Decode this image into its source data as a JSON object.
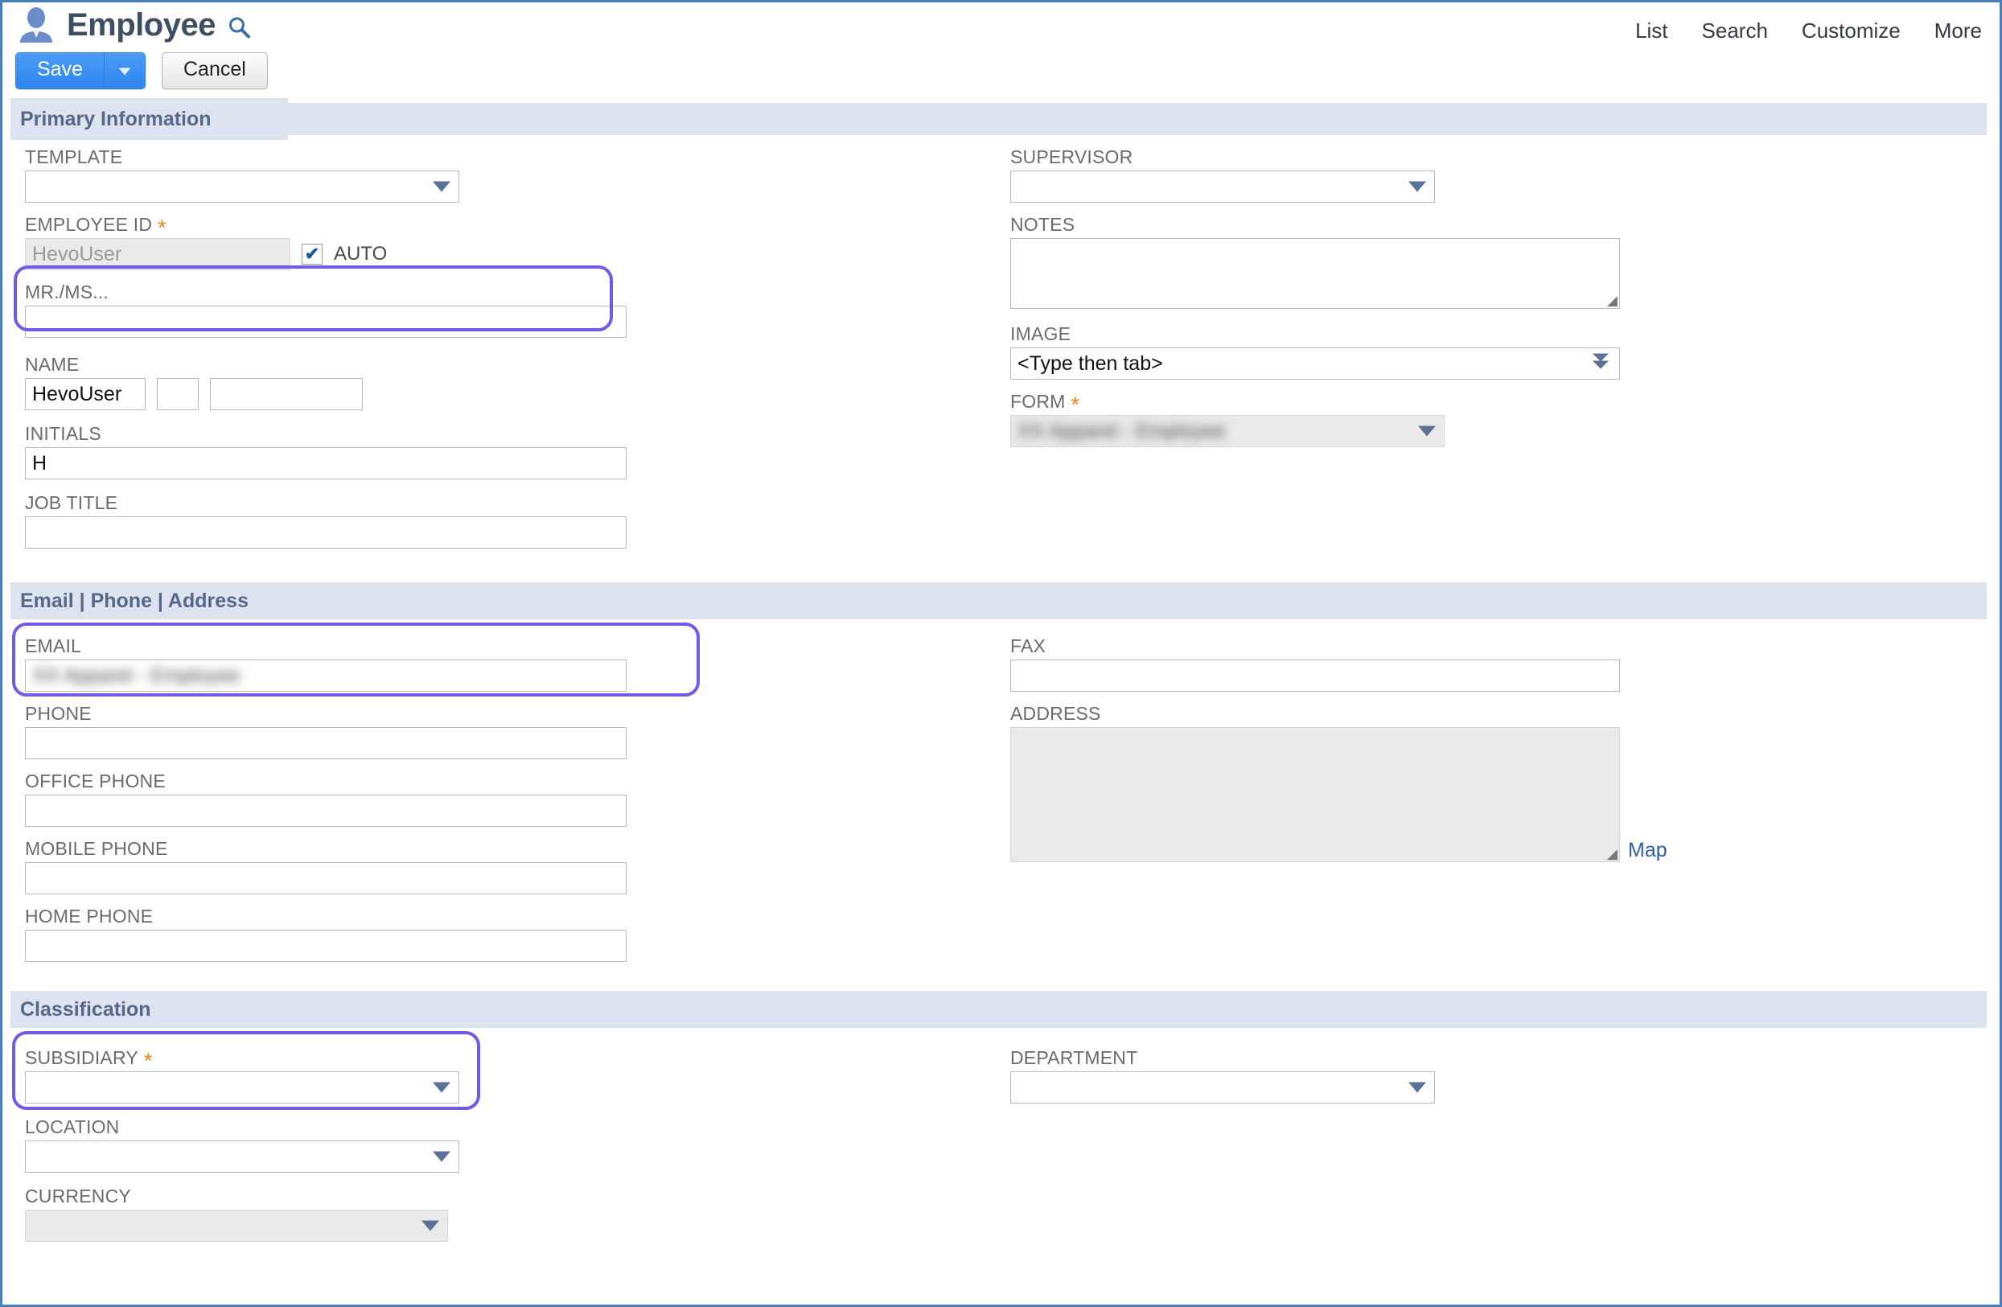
{
  "header": {
    "title": "Employee",
    "avatar_icon": "person-avatar-icon",
    "search_icon": "search-icon",
    "save_label": "Save",
    "save_caret_icon": "caret-down-icon",
    "cancel_label": "Cancel",
    "nav": [
      "List",
      "Search",
      "Customize",
      "More"
    ]
  },
  "sections": {
    "primary": {
      "title": "Primary Information",
      "template": {
        "label": "TEMPLATE",
        "value": "",
        "required": false
      },
      "employee_id": {
        "label": "EMPLOYEE ID",
        "value": "HevoUser",
        "required": true,
        "disabled": true
      },
      "auto": {
        "label": "AUTO",
        "checked": true,
        "check_glyph": "✔"
      },
      "mr_ms": {
        "label": "MR./MS...",
        "value": ""
      },
      "name": {
        "label": "NAME",
        "first": "HevoUser",
        "middle": "",
        "last": "",
        "highlighted": true
      },
      "initials": {
        "label": "INITIALS",
        "value": "H"
      },
      "job_title": {
        "label": "JOB TITLE",
        "value": ""
      },
      "supervisor": {
        "label": "SUPERVISOR",
        "value": ""
      },
      "notes": {
        "label": "NOTES",
        "value": ""
      },
      "image": {
        "label": "IMAGE",
        "value": "<Type then tab>"
      },
      "form": {
        "label": "FORM",
        "value": "",
        "value_redacted": "XX Apparel - Employee",
        "required": true,
        "disabled": true
      }
    },
    "contact": {
      "title": "Email | Phone | Address",
      "email": {
        "label": "EMAIL",
        "value": "",
        "value_redacted": "XX Apparel - Employee",
        "highlighted": true
      },
      "phone": {
        "label": "PHONE",
        "value": ""
      },
      "office_phone": {
        "label": "OFFICE PHONE",
        "value": ""
      },
      "mobile_phone": {
        "label": "MOBILE PHONE",
        "value": ""
      },
      "home_phone": {
        "label": "HOME PHONE",
        "value": ""
      },
      "fax": {
        "label": "FAX",
        "value": ""
      },
      "address": {
        "label": "ADDRESS",
        "value": "",
        "disabled": true
      },
      "map_link": "Map"
    },
    "classification": {
      "title": "Classification",
      "subsidiary": {
        "label": "SUBSIDIARY",
        "value": "",
        "required": true,
        "highlighted": true
      },
      "location": {
        "label": "LOCATION",
        "value": ""
      },
      "currency": {
        "label": "CURRENCY",
        "value": "",
        "disabled": true
      },
      "department": {
        "label": "DEPARTMENT",
        "value": ""
      }
    }
  },
  "colors": {
    "accent_blue": "#2f86ef",
    "section_band": "#dee4ef",
    "section_title": "#56688a",
    "highlight_purple": "#6c5ce7",
    "required_star": "#e08a14",
    "page_border": "#4a7ebb",
    "link_blue": "#2b5fa8"
  }
}
